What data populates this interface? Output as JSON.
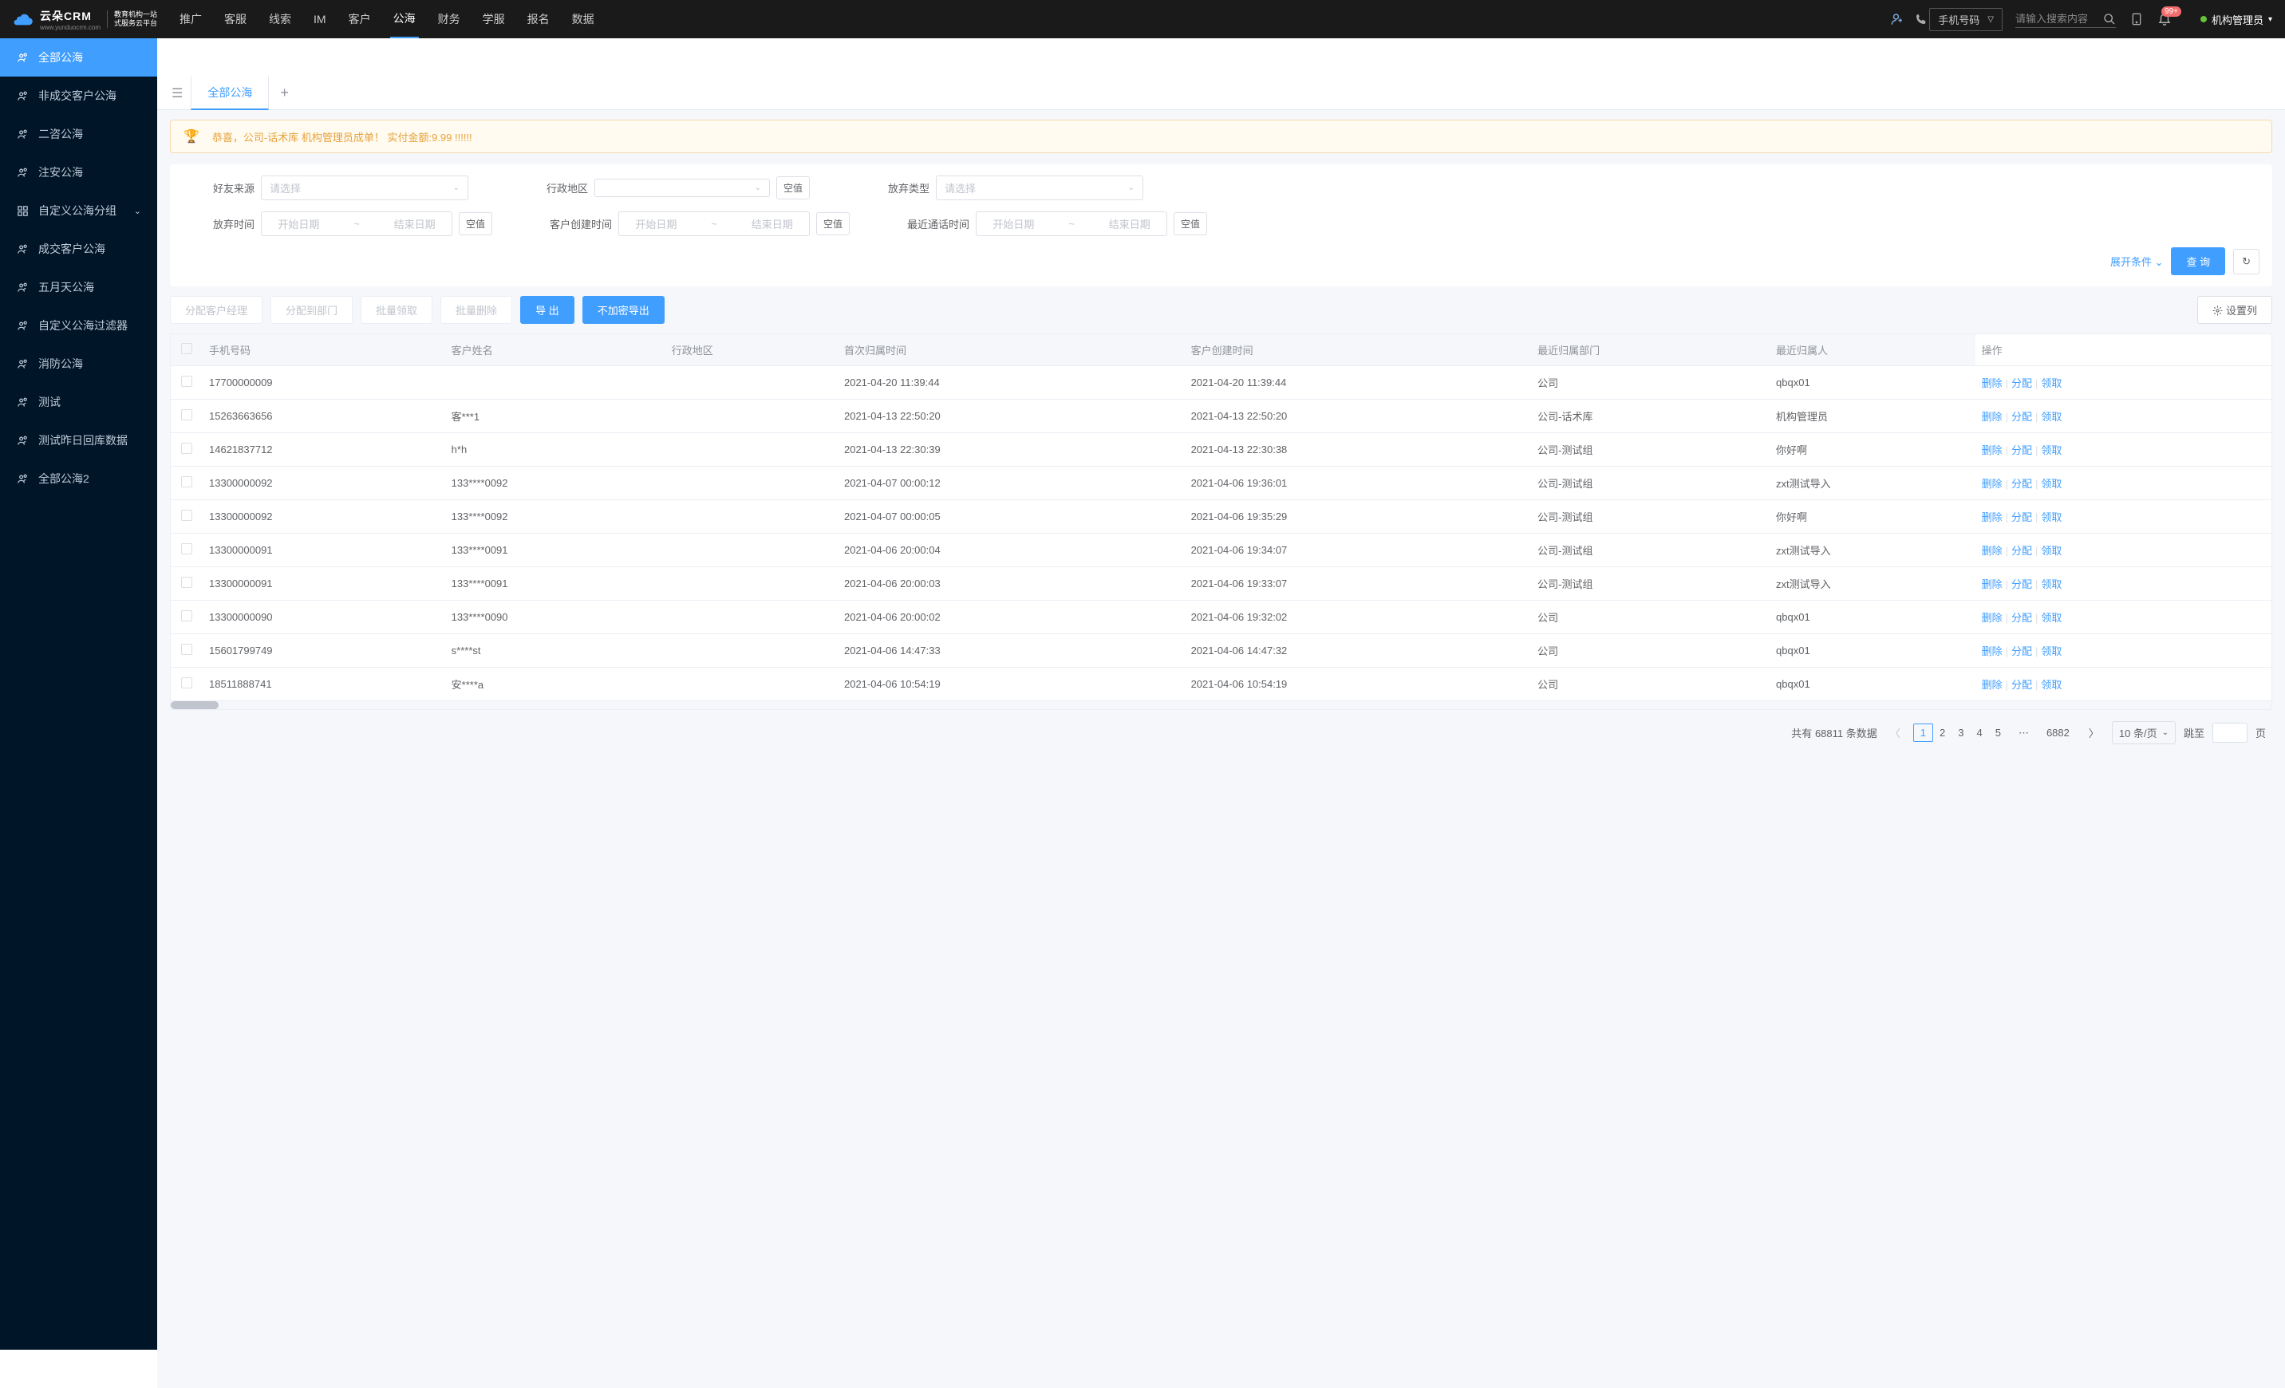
{
  "header": {
    "logo_text": "云朵CRM",
    "logo_url": "www.yunduocrm.com",
    "logo_sub1": "教育机构一站",
    "logo_sub2": "式服务云平台",
    "nav": [
      "推广",
      "客服",
      "线索",
      "IM",
      "客户",
      "公海",
      "财务",
      "学服",
      "报名",
      "数据"
    ],
    "nav_active_index": 5,
    "search_type": "手机号码",
    "search_placeholder": "请输入搜索内容",
    "badge": "99+",
    "user": "机构管理员"
  },
  "sidebar": {
    "items": [
      {
        "label": "全部公海",
        "active": true
      },
      {
        "label": "非成交客户公海"
      },
      {
        "label": "二咨公海"
      },
      {
        "label": "注安公海"
      },
      {
        "label": "自定义公海分组",
        "expandable": true
      },
      {
        "label": "成交客户公海"
      },
      {
        "label": "五月天公海"
      },
      {
        "label": "自定义公海过滤器"
      },
      {
        "label": "消防公海"
      },
      {
        "label": "测试"
      },
      {
        "label": "测试昨日回库数据"
      },
      {
        "label": "全部公海2"
      }
    ]
  },
  "tabs": {
    "active": "全部公海"
  },
  "banner": "恭喜，公司-话术库  机构管理员成单！  实付金额:9.99 !!!!!!",
  "filters": {
    "friend_source_label": "好友来源",
    "admin_region_label": "行政地区",
    "abandon_type_label": "放弃类型",
    "abandon_time_label": "放弃时间",
    "customer_create_label": "客户创建时间",
    "last_call_label": "最近通话时间",
    "please_select": "请选择",
    "start_date": "开始日期",
    "end_date": "结束日期",
    "tilde": "~",
    "null_btn": "空值",
    "expand": "展开条件",
    "query": "查 询"
  },
  "toolbar": {
    "assign_manager": "分配客户经理",
    "assign_dept": "分配到部门",
    "batch_claim": "批量领取",
    "batch_delete": "批量删除",
    "export": "导 出",
    "export_plain": "不加密导出",
    "set_columns": "设置列"
  },
  "table": {
    "columns": [
      "手机号码",
      "客户姓名",
      "行政地区",
      "首次归属时间",
      "客户创建时间",
      "最近归属部门",
      "最近归属人",
      "操作"
    ],
    "ops": {
      "delete": "删除",
      "assign": "分配",
      "claim": "领取"
    },
    "rows": [
      {
        "phone": "17700000009",
        "name": "",
        "region": "",
        "first_time": "2021-04-20 11:39:44",
        "create_time": "2021-04-20 11:39:44",
        "dept": "公司",
        "owner": "qbqx01"
      },
      {
        "phone": "15263663656",
        "name": "客***1",
        "region": "",
        "first_time": "2021-04-13 22:50:20",
        "create_time": "2021-04-13 22:50:20",
        "dept": "公司-话术库",
        "owner": "机构管理员"
      },
      {
        "phone": "14621837712",
        "name": "h*h",
        "region": "",
        "first_time": "2021-04-13 22:30:39",
        "create_time": "2021-04-13 22:30:38",
        "dept": "公司-测试组",
        "owner": "你好啊"
      },
      {
        "phone": "13300000092",
        "name": "133****0092",
        "region": "",
        "first_time": "2021-04-07 00:00:12",
        "create_time": "2021-04-06 19:36:01",
        "dept": "公司-测试组",
        "owner": "zxt测试导入"
      },
      {
        "phone": "13300000092",
        "name": "133****0092",
        "region": "",
        "first_time": "2021-04-07 00:00:05",
        "create_time": "2021-04-06 19:35:29",
        "dept": "公司-测试组",
        "owner": "你好啊"
      },
      {
        "phone": "13300000091",
        "name": "133****0091",
        "region": "",
        "first_time": "2021-04-06 20:00:04",
        "create_time": "2021-04-06 19:34:07",
        "dept": "公司-测试组",
        "owner": "zxt测试导入"
      },
      {
        "phone": "13300000091",
        "name": "133****0091",
        "region": "",
        "first_time": "2021-04-06 20:00:03",
        "create_time": "2021-04-06 19:33:07",
        "dept": "公司-测试组",
        "owner": "zxt测试导入"
      },
      {
        "phone": "13300000090",
        "name": "133****0090",
        "region": "",
        "first_time": "2021-04-06 20:00:02",
        "create_time": "2021-04-06 19:32:02",
        "dept": "公司",
        "owner": "qbqx01"
      },
      {
        "phone": "15601799749",
        "name": "s****st",
        "region": "",
        "first_time": "2021-04-06 14:47:33",
        "create_time": "2021-04-06 14:47:32",
        "dept": "公司",
        "owner": "qbqx01"
      },
      {
        "phone": "18511888741",
        "name": "安****a",
        "region": "",
        "first_time": "2021-04-06 10:54:19",
        "create_time": "2021-04-06 10:54:19",
        "dept": "公司",
        "owner": "qbqx01"
      }
    ]
  },
  "pagination": {
    "total_prefix": "共有",
    "total": "68811",
    "total_suffix": "条数据",
    "pages": [
      "1",
      "2",
      "3",
      "4",
      "5"
    ],
    "last_page": "6882",
    "page_size": "10 条/页",
    "jump_prefix": "跳至",
    "jump_suffix": "页"
  }
}
